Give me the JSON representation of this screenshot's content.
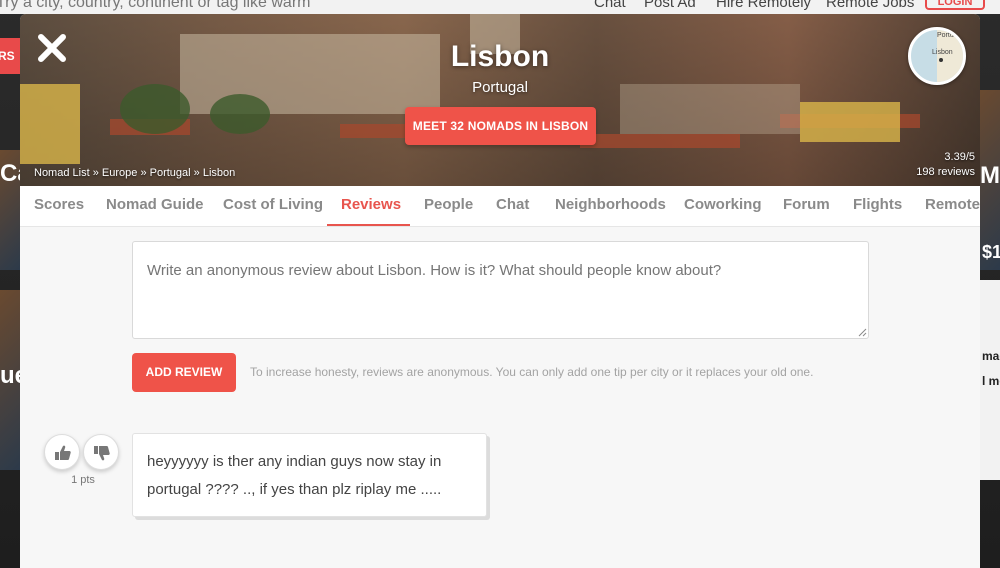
{
  "background": {
    "search_placeholder": "Try a city, country, continent or tag like warm",
    "nav_items": [
      "Chat",
      "Post Ad",
      "Hire Remotely",
      "Remote Jobs"
    ],
    "login_label": "LOGIN",
    "left_button_label": "RS",
    "card_texts": [
      "Ca",
      "ue",
      "Ma",
      "$1",
      "made",
      "l me"
    ]
  },
  "hero": {
    "city": "Lisbon",
    "country": "Portugal",
    "meet_button": "MEET 32 NOMADS IN LISBON",
    "map_labels": [
      "Portu",
      "Lisbon"
    ],
    "breadcrumb": [
      "Nomad List",
      "Europe",
      "Portugal",
      "Lisbon"
    ],
    "breadcrumb_sep": "»",
    "rating": "3.39/5",
    "reviews_count": "198 reviews"
  },
  "tabs": [
    "Scores",
    "Nomad Guide",
    "Cost of Living",
    "Reviews",
    "People",
    "Chat",
    "Neighborhoods",
    "Coworking",
    "Forum",
    "Flights",
    "Remote"
  ],
  "active_tab": "Reviews",
  "review_form": {
    "placeholder": "Write an anonymous review about Lisbon. How is it? What should people know about?",
    "add_button": "ADD REVIEW",
    "hint": "To increase honesty, reviews are anonymous. You can only add one tip per city or it replaces your old one."
  },
  "reviews": [
    {
      "points": "1 pts",
      "text": "heyyyyyy is ther any indian guys now stay in portugal ???? .., if yes than plz riplay me ....."
    }
  ],
  "colors": {
    "accent": "#ef5349",
    "tab_inactive": "#8a8a8a",
    "tab_active": "#e8554e"
  }
}
